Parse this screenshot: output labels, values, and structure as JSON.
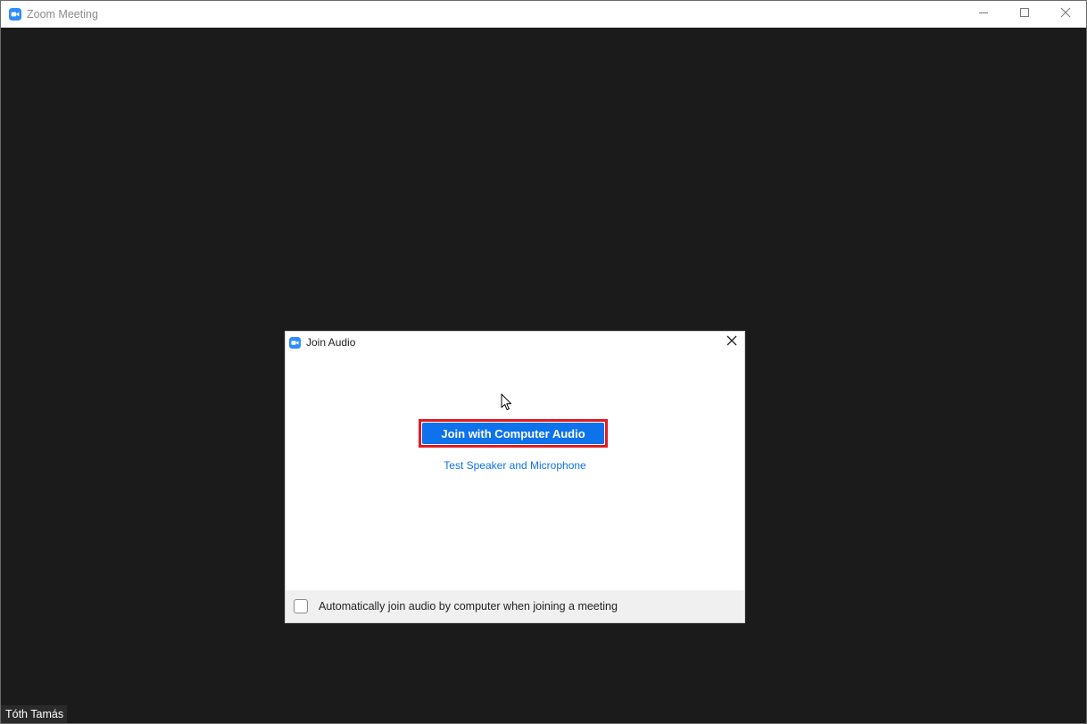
{
  "window": {
    "title": "Zoom Meeting",
    "accent_color": "#2D8CFF",
    "background_color": "#1B1B1B"
  },
  "participant": {
    "name": "Tóth Tamás"
  },
  "dialog": {
    "title": "Join Audio",
    "join_button_label": "Join with Computer Audio",
    "join_button_color": "#0E72ED",
    "highlight_color": "#E21B23",
    "test_link_label": "Test Speaker and Microphone",
    "auto_join_label": "Automatically join audio by computer when joining a meeting",
    "auto_join_checked": false
  },
  "icons": {
    "app": "zoom-camera-icon",
    "minimize": "minimize-icon",
    "maximize": "maximize-icon",
    "close": "close-icon",
    "cursor": "mouse-cursor-icon"
  }
}
